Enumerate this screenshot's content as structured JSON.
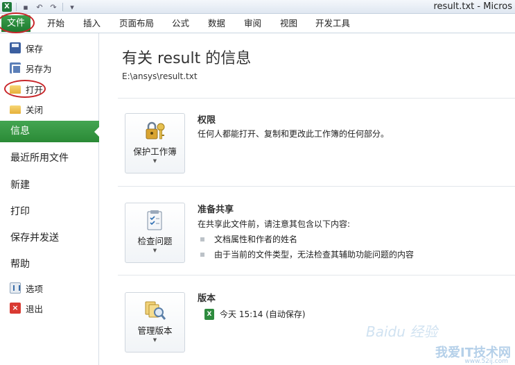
{
  "window": {
    "title": "result.txt  -  Micros"
  },
  "qat": {
    "app_icon": "X"
  },
  "ribbon": {
    "file_tab": "文件",
    "tabs": [
      "开始",
      "插入",
      "页面布局",
      "公式",
      "数据",
      "审阅",
      "视图",
      "开发工具"
    ]
  },
  "nav": {
    "save": "保存",
    "save_as": "另存为",
    "open": "打开",
    "close": "关闭",
    "info": "信息",
    "recent": "最近所用文件",
    "new": "新建",
    "print": "打印",
    "save_send": "保存并发送",
    "help": "帮助",
    "options": "选项",
    "exit": "退出"
  },
  "info": {
    "title": "有关 result 的信息",
    "path": "E:\\ansys\\result.txt",
    "permissions": {
      "button": "保护工作簿",
      "title": "权限",
      "desc": "任何人都能打开、复制和更改此工作簿的任何部分。"
    },
    "prepare": {
      "button": "检查问题",
      "title": "准备共享",
      "desc": "在共享此文件前，请注意其包含以下内容:",
      "bullets": [
        "文档属性和作者的姓名",
        "由于当前的文件类型，无法检查其辅助功能问题的内容"
      ]
    },
    "versions": {
      "button": "管理版本",
      "title": "版本",
      "item": "今天 15:14 (自动保存)"
    }
  },
  "watermark": {
    "top": "Baidu 经验",
    "main": "我爱IT技术网",
    "url": "www.52ij.com"
  },
  "colors": {
    "accent": "#2a8a36",
    "annotation": "#c8262a"
  }
}
